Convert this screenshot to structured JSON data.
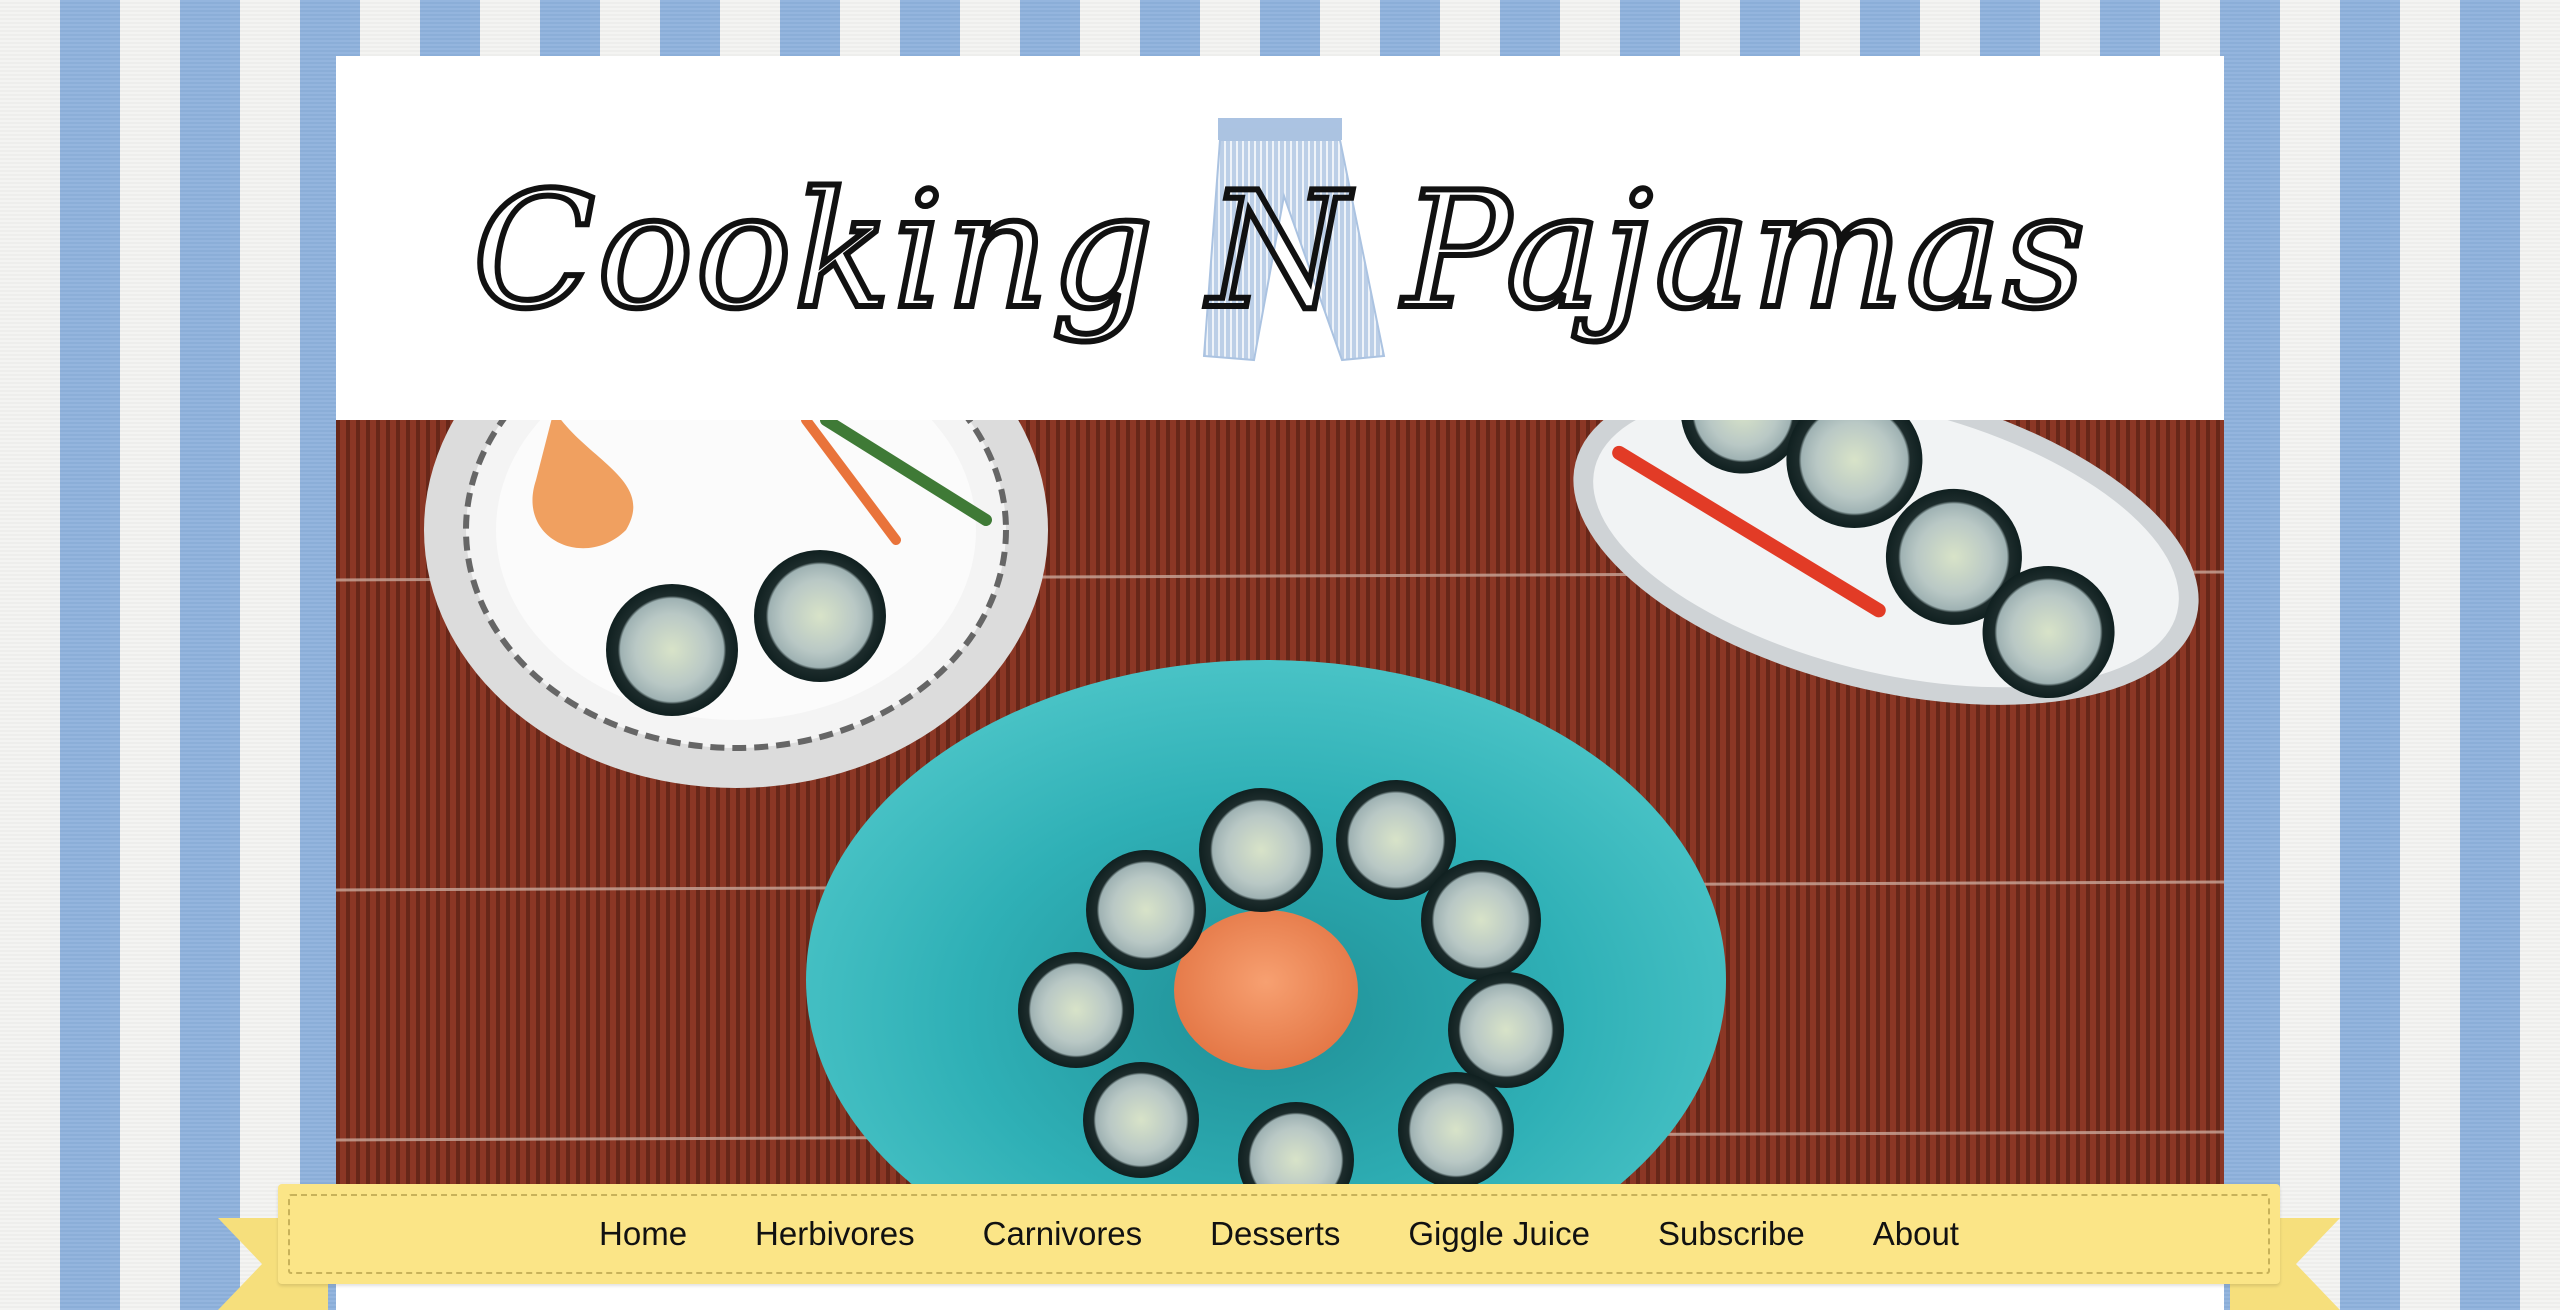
{
  "site": {
    "logo_text": "Cooking N Pajamas"
  },
  "nav": {
    "items": [
      {
        "label": "Home"
      },
      {
        "label": "Herbivores"
      },
      {
        "label": "Carnivores"
      },
      {
        "label": "Desserts"
      },
      {
        "label": "Giggle Juice"
      },
      {
        "label": "Subscribe"
      },
      {
        "label": "About"
      }
    ]
  },
  "colors": {
    "stripe_blue": "#8eb1dc",
    "stripe_white": "#f3f3f1",
    "ribbon_yellow": "#fbe587",
    "placemat_red": "#8e3a26",
    "plate_teal": "#2fa9ae"
  },
  "hero": {
    "image": "sushi-rolls-on-plates-over-bamboo-placemat"
  }
}
